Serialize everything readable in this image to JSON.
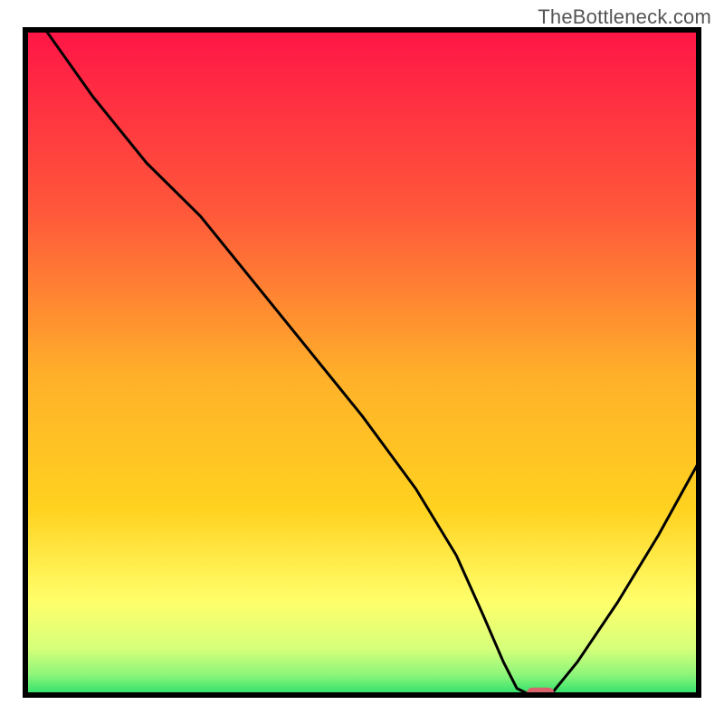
{
  "watermark": "TheBottleneck.com",
  "colors": {
    "frame": "#000000",
    "curve": "#000000",
    "marker_fill": "#d9636c",
    "grad_top": "#ff1547",
    "grad_mid1": "#ff7a33",
    "grad_mid2": "#ffd21f",
    "grad_mid3": "#ffff6b",
    "grad_mid4": "#d6ff7a",
    "grad_bottom": "#29e06b"
  },
  "chart_data": {
    "type": "line",
    "title": "",
    "xlabel": "",
    "ylabel": "",
    "xlim": [
      0,
      100
    ],
    "ylim": [
      0,
      100
    ],
    "series": [
      {
        "name": "bottleneck-curve",
        "x": [
          3,
          10,
          18,
          26,
          34,
          42,
          50,
          58,
          64,
          68,
          71,
          73,
          75,
          78,
          82,
          88,
          94,
          100
        ],
        "y": [
          100,
          90,
          80,
          72,
          62,
          52,
          42,
          31,
          21,
          12,
          5,
          1,
          0,
          0,
          5,
          14,
          24,
          35
        ]
      }
    ],
    "marker": {
      "x": 76.5,
      "y": 0,
      "width": 4,
      "height": 1.4
    },
    "notes": "Background is a vertical heat gradient from red (top) through orange/yellow to green (bottom). A single black curve descends from upper-left, with a slight slope change near x≈26, reaches zero (the green baseline) around x≈73–78 where a small rounded red marker sits on the axis, then rises toward the right edge. Values are read off relative to the plot box; no numeric axis ticks are shown."
  }
}
